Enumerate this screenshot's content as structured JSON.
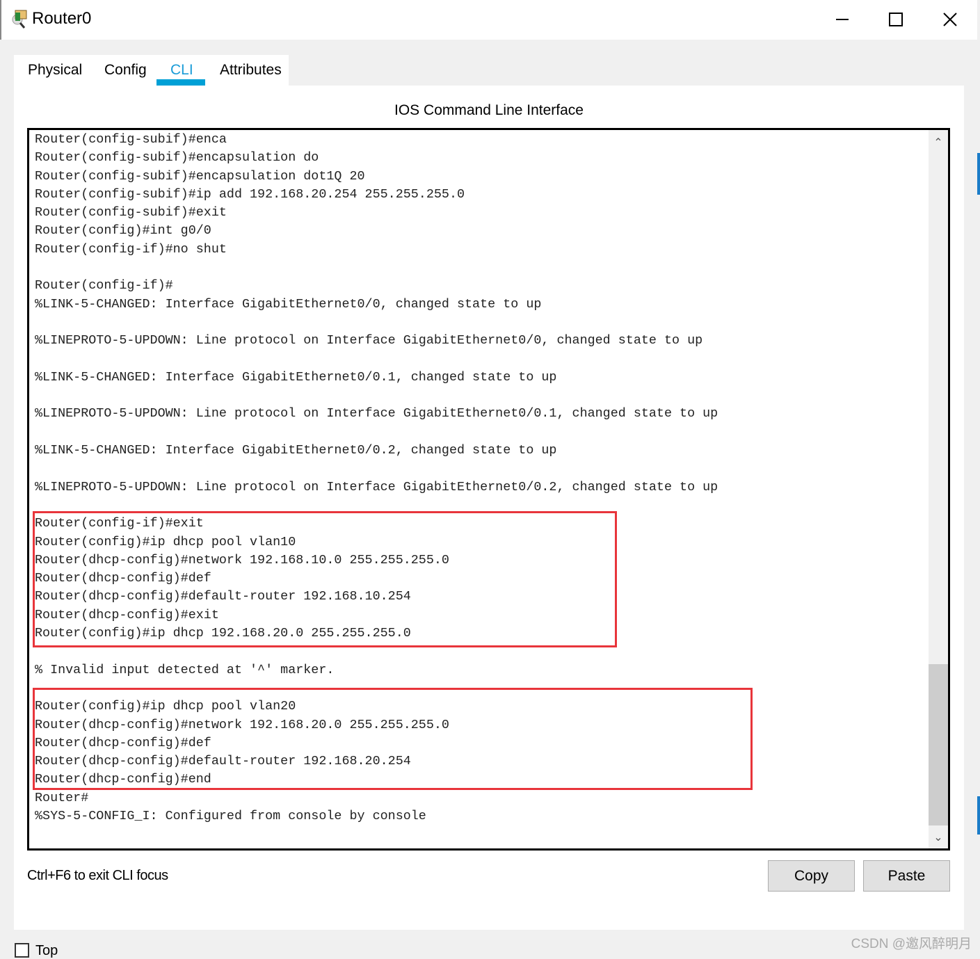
{
  "window": {
    "title": "Router0",
    "icon": "router-icon",
    "controls": [
      "minimize",
      "maximize",
      "close"
    ]
  },
  "tabs": [
    {
      "label": "Physical"
    },
    {
      "label": "Config"
    },
    {
      "label": "CLI",
      "active": true
    },
    {
      "label": "Attributes"
    }
  ],
  "panel": {
    "title": "IOS Command Line Interface"
  },
  "terminal": {
    "lines": [
      "Router(config-subif)#enca",
      "Router(config-subif)#encapsulation do",
      "Router(config-subif)#encapsulation dot1Q 20",
      "Router(config-subif)#ip add 192.168.20.254 255.255.255.0",
      "Router(config-subif)#exit",
      "Router(config)#int g0/0",
      "Router(config-if)#no shut",
      "",
      "Router(config-if)#",
      "%LINK-5-CHANGED: Interface GigabitEthernet0/0, changed state to up",
      "",
      "%LINEPROTO-5-UPDOWN: Line protocol on Interface GigabitEthernet0/0, changed state to up",
      "",
      "%LINK-5-CHANGED: Interface GigabitEthernet0/0.1, changed state to up",
      "",
      "%LINEPROTO-5-UPDOWN: Line protocol on Interface GigabitEthernet0/0.1, changed state to up",
      "",
      "%LINK-5-CHANGED: Interface GigabitEthernet0/0.2, changed state to up",
      "",
      "%LINEPROTO-5-UPDOWN: Line protocol on Interface GigabitEthernet0/0.2, changed state to up",
      "",
      "Router(config-if)#exit",
      "Router(config)#ip dhcp pool vlan10",
      "Router(dhcp-config)#network 192.168.10.0 255.255.255.0",
      "Router(dhcp-config)#def",
      "Router(dhcp-config)#default-router 192.168.10.254",
      "Router(dhcp-config)#exit",
      "Router(config)#ip dhcp 192.168.20.0 255.255.255.0",
      "",
      "% Invalid input detected at '^' marker.",
      "",
      "Router(config)#ip dhcp pool vlan20",
      "Router(dhcp-config)#network 192.168.20.0 255.255.255.0",
      "Router(dhcp-config)#def",
      "Router(dhcp-config)#default-router 192.168.20.254",
      "Router(dhcp-config)#end",
      "Router#",
      "%SYS-5-CONFIG_I: Configured from console by console"
    ]
  },
  "highlight_color": "#e8353b",
  "accent_color": "#00a0d6",
  "footer": {
    "hint": "Ctrl+F6 to exit CLI focus",
    "copy_label": "Copy",
    "paste_label": "Paste"
  },
  "bottom": {
    "top_checkbox_label": "Top",
    "top_checked": false,
    "watermark": "CSDN @邀风醉明月"
  }
}
